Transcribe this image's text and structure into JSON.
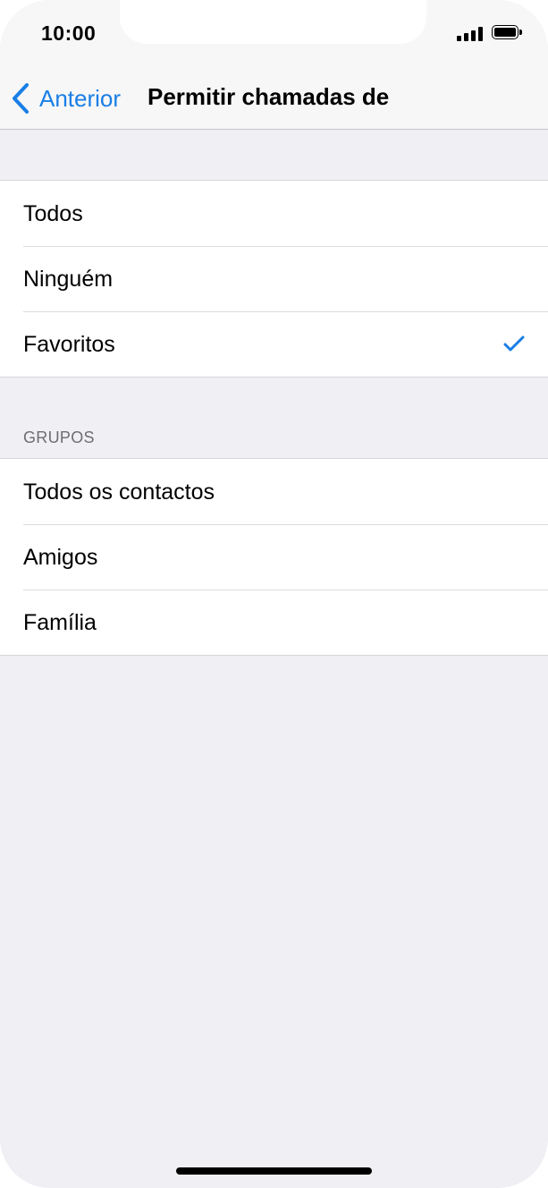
{
  "status_bar": {
    "time": "10:00"
  },
  "nav": {
    "back_label": "Anterior",
    "title": "Permitir chamadas de"
  },
  "options": {
    "items": [
      {
        "label": "Todos",
        "selected": false
      },
      {
        "label": "Ninguém",
        "selected": false
      },
      {
        "label": "Favoritos",
        "selected": true
      }
    ]
  },
  "groups": {
    "header": "GRUPOS",
    "items": [
      {
        "label": "Todos os contactos"
      },
      {
        "label": "Amigos"
      },
      {
        "label": "Família"
      }
    ]
  },
  "colors": {
    "accent": "#1a7ee6",
    "background": "#efeff4",
    "bar_background": "#f7f7f7",
    "section_header": "#6d6d72"
  },
  "icons": {
    "back": "chevron-left-icon",
    "selected": "checkmark-icon",
    "signal": "cellular-signal-icon",
    "battery": "battery-icon"
  }
}
